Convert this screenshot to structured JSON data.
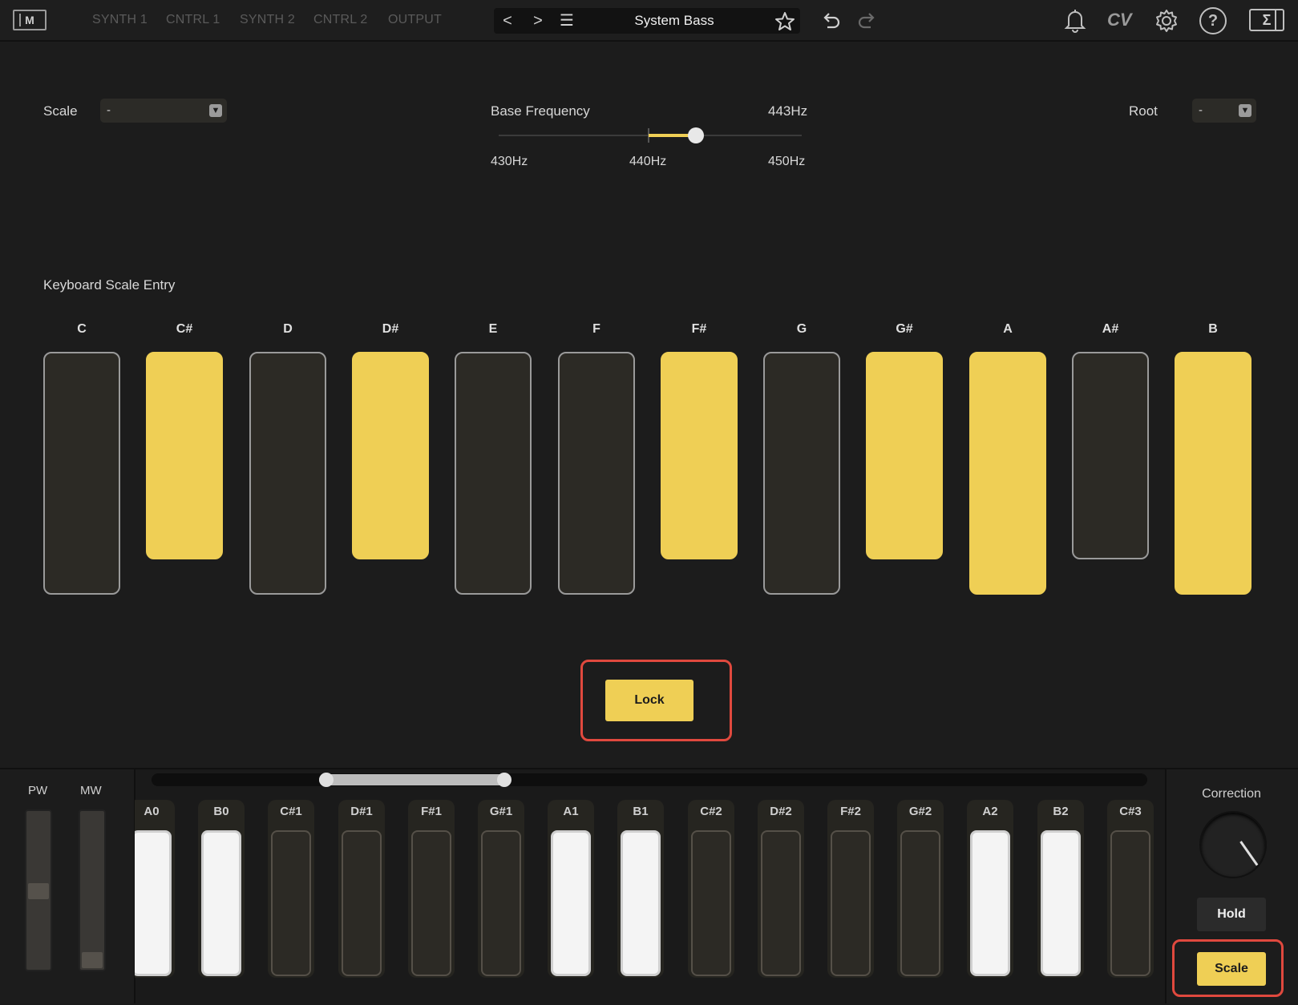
{
  "topbar": {
    "logo": "M",
    "tabs": [
      "SYNTH 1",
      "CNTRL 1",
      "SYNTH 2",
      "CNTRL 2",
      "OUTPUT"
    ],
    "preset_name": "System Bass",
    "prev_label": "<",
    "next_label": ">",
    "menu_label": "☰",
    "cv_label": "CV",
    "help_label": "?",
    "sigma_label": "Σ"
  },
  "scale_settings": {
    "scale_label": "Scale",
    "scale_value": "-",
    "base_frequency_label": "Base Frequency",
    "base_frequency_value": "443Hz",
    "base_frequency_numeric": 443,
    "freq_min_label": "430Hz",
    "freq_mid_label": "440Hz",
    "freq_max_label": "450Hz",
    "root_label": "Root",
    "root_value": "-"
  },
  "scale_entry": {
    "title": "Keyboard Scale Entry",
    "notes": [
      {
        "name": "C",
        "active": false
      },
      {
        "name": "C#",
        "active": true
      },
      {
        "name": "D",
        "active": false
      },
      {
        "name": "D#",
        "active": true
      },
      {
        "name": "E",
        "active": false
      },
      {
        "name": "F",
        "active": false
      },
      {
        "name": "F#",
        "active": true
      },
      {
        "name": "G",
        "active": false
      },
      {
        "name": "G#",
        "active": true
      },
      {
        "name": "A",
        "active": true
      },
      {
        "name": "A#",
        "active": false
      },
      {
        "name": "B",
        "active": true
      }
    ],
    "lock_label": "Lock"
  },
  "keyboard": {
    "pw_label": "PW",
    "mw_label": "MW",
    "keys": [
      {
        "label": "A0",
        "state": "white"
      },
      {
        "label": "B0",
        "state": "white"
      },
      {
        "label": "C#1",
        "state": "dark"
      },
      {
        "label": "D#1",
        "state": "dark"
      },
      {
        "label": "F#1",
        "state": "dark"
      },
      {
        "label": "G#1",
        "state": "dark"
      },
      {
        "label": "A1",
        "state": "white"
      },
      {
        "label": "B1",
        "state": "white"
      },
      {
        "label": "C#2",
        "state": "dark"
      },
      {
        "label": "D#2",
        "state": "dark"
      },
      {
        "label": "F#2",
        "state": "dark"
      },
      {
        "label": "G#2",
        "state": "dark"
      },
      {
        "label": "A2",
        "state": "white"
      },
      {
        "label": "B2",
        "state": "white"
      },
      {
        "label": "C#3",
        "state": "dark"
      }
    ]
  },
  "right_panel": {
    "correction_label": "Correction",
    "hold_label": "Hold",
    "scale_label": "Scale"
  },
  "colors": {
    "accent": "#efcf55",
    "background": "#1c1c1c",
    "highlight": "#e0493e"
  }
}
